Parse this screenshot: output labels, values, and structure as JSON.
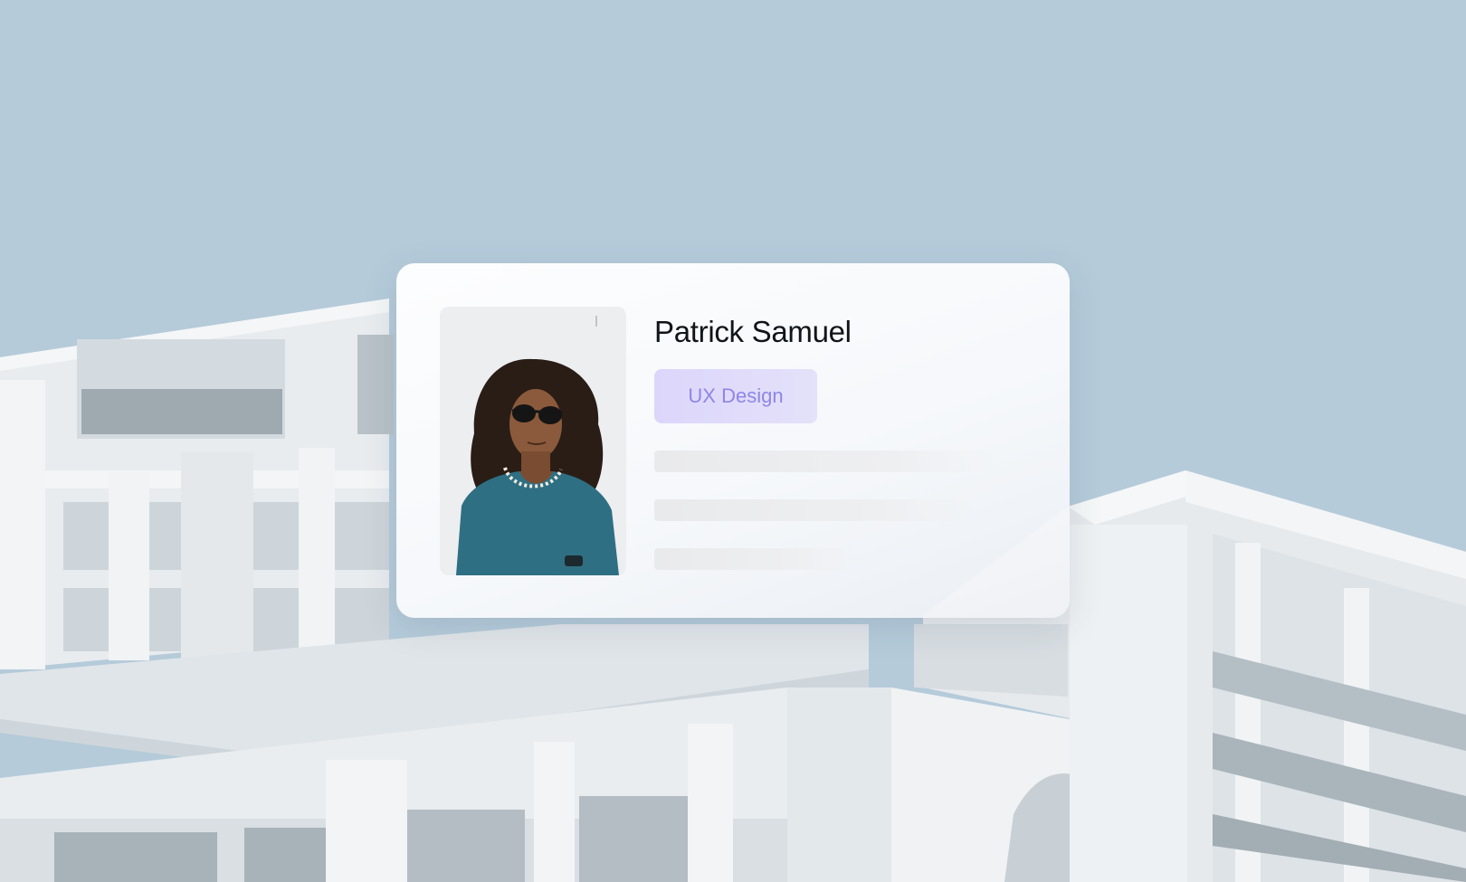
{
  "profile_card": {
    "name": "Patrick Samuel",
    "tag_label": "UX Design",
    "photo_alt": "Patrick Samuel"
  },
  "colors": {
    "sky": "#b5cbda",
    "building": "#e9edf0",
    "tag_bg": "#dcd6fb",
    "tag_text": "#8f86e6",
    "skeleton": "#ebecee"
  }
}
